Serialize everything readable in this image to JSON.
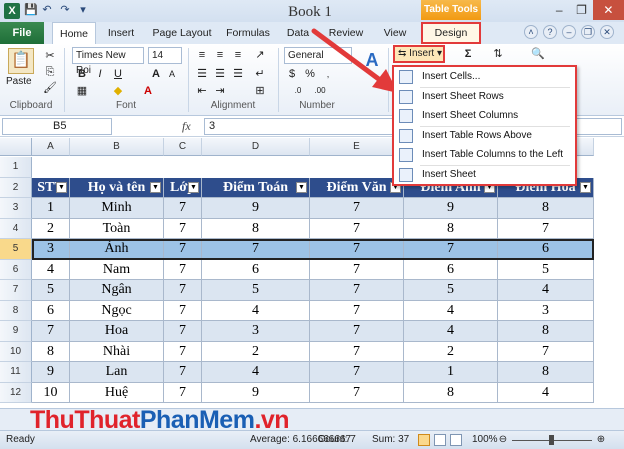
{
  "window": {
    "title": "Book 1",
    "contextual_tab": "Table Tools",
    "app_icon": "X",
    "window_buttons": [
      "–",
      "❐",
      "✕"
    ]
  },
  "tabs": [
    "File",
    "Home",
    "Insert",
    "Page Layout",
    "Formulas",
    "Data",
    "Review",
    "View",
    "Design"
  ],
  "ribbon": {
    "clipboard": {
      "paste_label": "Paste",
      "group_label": "Clipboard"
    },
    "font": {
      "name": "Times New Roi",
      "size": "14",
      "group_label": "Font"
    },
    "alignment": {
      "group_label": "Alignment"
    },
    "number": {
      "format": "General",
      "group_label": "Number"
    },
    "cells": {
      "insert_label": "Insert"
    },
    "editing": {
      "sigma": "Σ"
    }
  },
  "formula_bar": {
    "name_box": "B5",
    "fx": "fx",
    "value": "3"
  },
  "columns": [
    "",
    "A",
    "B",
    "C",
    "D",
    "E",
    "F"
  ],
  "rows": [
    "1",
    "2",
    "3",
    "4",
    "5",
    "6",
    "7",
    "8",
    "9",
    "10",
    "11",
    "12"
  ],
  "table": {
    "headers": [
      "STT",
      "Họ và tên",
      "Lớp",
      "Điểm Toán",
      "Điểm Văn",
      "Điểm Anh",
      "Điểm Hoá"
    ],
    "rows": [
      [
        "1",
        "Minh",
        "7",
        "9",
        "7",
        "9",
        "8"
      ],
      [
        "2",
        "Toàn",
        "7",
        "8",
        "7",
        "8",
        "7"
      ],
      [
        "3",
        "Ánh",
        "7",
        "7",
        "7",
        "7",
        "6"
      ],
      [
        "4",
        "Nam",
        "7",
        "6",
        "7",
        "6",
        "5"
      ],
      [
        "5",
        "Ngân",
        "7",
        "5",
        "7",
        "5",
        "4"
      ],
      [
        "6",
        "Ngọc",
        "7",
        "4",
        "7",
        "4",
        "3"
      ],
      [
        "7",
        "Hoa",
        "7",
        "3",
        "7",
        "4",
        "8"
      ],
      [
        "8",
        "Nhài",
        "7",
        "2",
        "7",
        "2",
        "7"
      ],
      [
        "9",
        "Lan",
        "7",
        "4",
        "7",
        "1",
        "8"
      ],
      [
        "10",
        "Huệ",
        "7",
        "9",
        "7",
        "8",
        "4"
      ]
    ]
  },
  "insert_menu": [
    "Insert Cells...",
    "Insert Sheet Rows",
    "Insert Sheet Columns",
    "Insert Table Rows Above",
    "Insert Table Columns to the Left",
    "Insert Sheet"
  ],
  "watermark": {
    "part1": "ThuThuat",
    "part2": "PhanMem",
    "part3": ".vn"
  },
  "status": {
    "ready": "Ready",
    "average": "Average: 6.166666667",
    "count": "Count: 7",
    "sum": "Sum: 37",
    "zoom": "100%"
  },
  "colors": {
    "table_header": "#2e4d8c",
    "band": "#dbe5f1",
    "selected": "#9dc3e6",
    "annotation": "#e23a3a"
  }
}
